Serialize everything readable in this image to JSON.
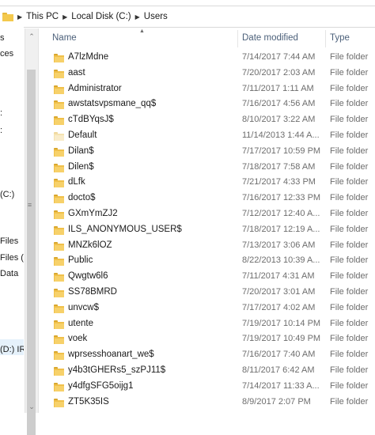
{
  "address": {
    "crumbs": [
      "This PC",
      "Local Disk (C:)",
      "Users"
    ]
  },
  "nav": {
    "items": [
      "s",
      "ces",
      ":",
      ":",
      "(C:)",
      "Files",
      "Files (x",
      "Data",
      "(D:) IR"
    ]
  },
  "columns": {
    "name": "Name",
    "date": "Date modified",
    "type": "Type"
  },
  "files": [
    {
      "name": "A7lzMdne",
      "date": "7/14/2017 7:44 AM",
      "type": "File folder"
    },
    {
      "name": "aast",
      "date": "7/20/2017 2:03 AM",
      "type": "File folder"
    },
    {
      "name": "Administrator",
      "date": "7/11/2017 1:11 AM",
      "type": "File folder"
    },
    {
      "name": "awstatsvpsmane_qq$",
      "date": "7/16/2017 4:56 AM",
      "type": "File folder"
    },
    {
      "name": "cTdBYqsJ$",
      "date": "8/10/2017 3:22 AM",
      "type": "File folder"
    },
    {
      "name": "Default",
      "date": "11/14/2013 1:44 A...",
      "type": "File folder",
      "hidden": true
    },
    {
      "name": "Dilan$",
      "date": "7/17/2017 10:59 PM",
      "type": "File folder"
    },
    {
      "name": "Dilen$",
      "date": "7/18/2017 7:58 AM",
      "type": "File folder"
    },
    {
      "name": "dLfk",
      "date": "7/21/2017 4:33 PM",
      "type": "File folder"
    },
    {
      "name": "docto$",
      "date": "7/16/2017 12:33 PM",
      "type": "File folder"
    },
    {
      "name": "GXmYmZJ2",
      "date": "7/12/2017 12:40 A...",
      "type": "File folder"
    },
    {
      "name": "ILS_ANONYMOUS_USER$",
      "date": "7/18/2017 12:19 A...",
      "type": "File folder"
    },
    {
      "name": "MNZk6lOZ",
      "date": "7/13/2017 3:06 AM",
      "type": "File folder"
    },
    {
      "name": "Public",
      "date": "8/22/2013 10:39 A...",
      "type": "File folder"
    },
    {
      "name": "Qwgtw6l6",
      "date": "7/11/2017 4:31 AM",
      "type": "File folder"
    },
    {
      "name": "SS78BMRD",
      "date": "7/20/2017 3:01 AM",
      "type": "File folder"
    },
    {
      "name": "unvcw$",
      "date": "7/17/2017 4:02 AM",
      "type": "File folder"
    },
    {
      "name": "utente",
      "date": "7/19/2017 10:14 PM",
      "type": "File folder"
    },
    {
      "name": "voek",
      "date": "7/19/2017 10:49 PM",
      "type": "File folder"
    },
    {
      "name": "wprsesshoanart_we$",
      "date": "7/16/2017 7:40 AM",
      "type": "File folder"
    },
    {
      "name": "y4b3tGHERs5_szPJ11$",
      "date": "8/11/2017 6:42 AM",
      "type": "File folder"
    },
    {
      "name": "y4dfgSFG5oijg1",
      "date": "7/14/2017 11:33 A...",
      "type": "File folder"
    },
    {
      "name": "ZT5K35IS",
      "date": "8/9/2017 2:07 PM",
      "type": "File folder"
    }
  ]
}
